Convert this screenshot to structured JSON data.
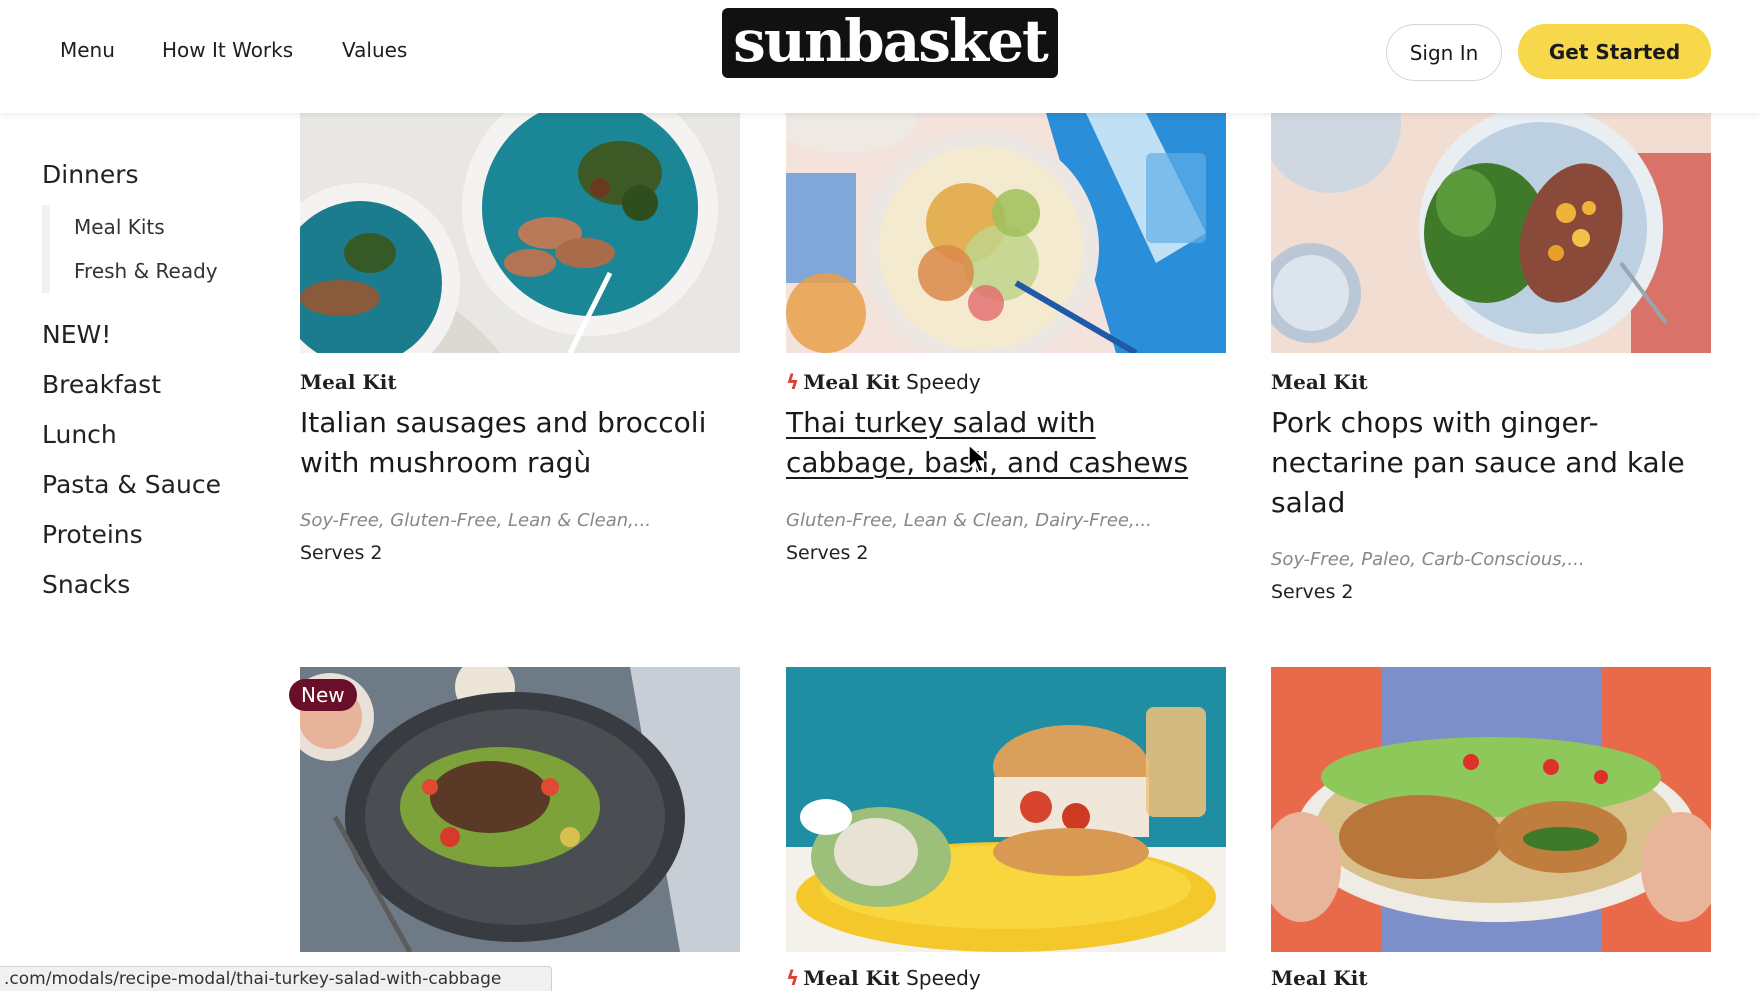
{
  "header": {
    "nav": [
      "Menu",
      "How It Works",
      "Values"
    ],
    "logo_text": "sunbasket",
    "signin_label": "Sign In",
    "getstarted_label": "Get Started"
  },
  "sidebar": {
    "dinners": "Dinners",
    "sub_items": [
      "Meal Kits",
      "Fresh & Ready"
    ],
    "categories": [
      "NEW!",
      "Breakfast",
      "Lunch",
      "Pasta & Sauce",
      "Proteins",
      "Snacks"
    ]
  },
  "cards": [
    {
      "kit": "Meal Kit",
      "speedy": "",
      "title": "Italian sausages and broccoli with mushroom ragù",
      "diets": "Soy-Free, Gluten-Free, Lean & Clean,...",
      "serves": "Serves 2"
    },
    {
      "kit": "Meal Kit",
      "speedy": "Speedy",
      "title": "Thai turkey salad with cabbage, basil, and cashews",
      "diets": "Gluten-Free, Lean & Clean, Dairy-Free,...",
      "serves": "Serves 2"
    },
    {
      "kit": "Meal Kit",
      "speedy": "",
      "title": "Pork chops with ginger-nectarine pan sauce and kale salad",
      "diets": "Soy-Free, Paleo, Carb-Conscious,...",
      "serves": "Serves 2"
    },
    {
      "kit": "",
      "speedy": "",
      "badge": "New"
    },
    {
      "kit": "Meal Kit",
      "speedy": "Speedy"
    },
    {
      "kit": "Meal Kit",
      "speedy": ""
    }
  ],
  "status_url": ".com/modals/recipe-modal/thai-turkey-salad-with-cabbage",
  "colors": {
    "accent_yellow": "#f6d84a",
    "badge_maroon": "#6a0f2a",
    "bolt_red": "#d64436"
  }
}
